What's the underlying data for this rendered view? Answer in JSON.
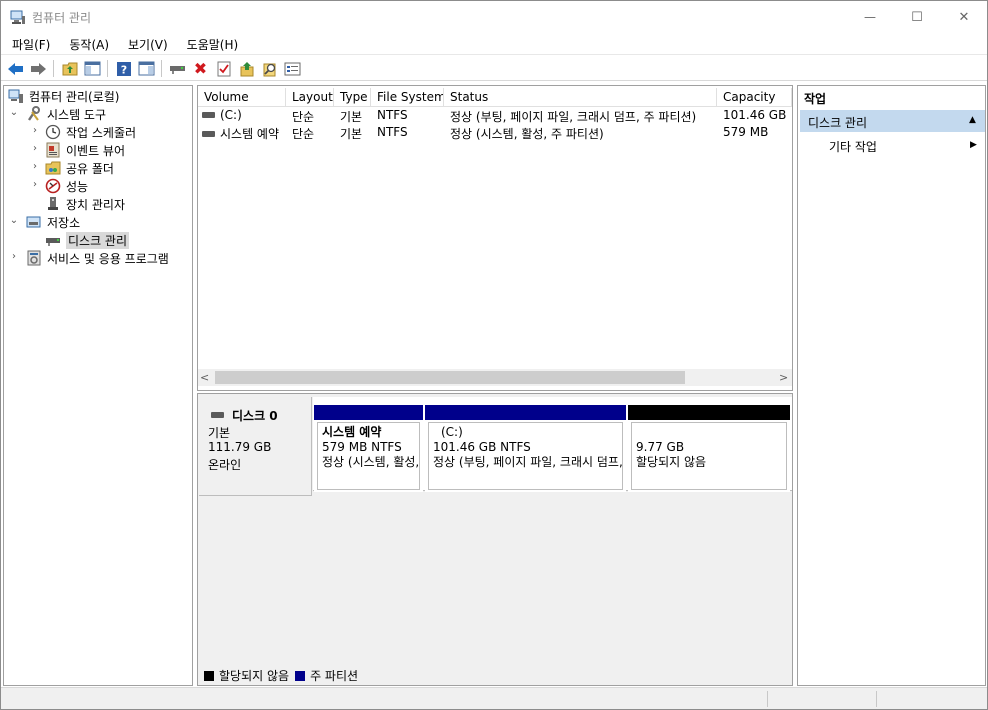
{
  "window": {
    "title": "컴퓨터 관리",
    "minimize_glyph": "—",
    "maximize_glyph": "☐",
    "close_glyph": "✕"
  },
  "menu": [
    "파일(F)",
    "동작(A)",
    "보기(V)",
    "도움말(H)"
  ],
  "toolbar": {
    "icons": [
      "back-arrow-icon",
      "forward-arrow-icon",
      "up-folder-icon",
      "show-hide-console-tree-icon",
      "help-icon",
      "show-hide-action-pane-icon",
      "connect-drive-icon",
      "delete-icon",
      "check-icon",
      "folder-up-icon",
      "search-icon",
      "properties-icon"
    ],
    "delete_glyph": "✖",
    "back_color": "#1f6fc5",
    "delete_color": "#d0191e"
  },
  "tree": {
    "root": "컴퓨터 관리(로컬)",
    "system_tools": "시스템 도구",
    "task_scheduler": "작업 스케줄러",
    "event_viewer": "이벤트 뷰어",
    "shared_folders": "공유 폴더",
    "performance": "성능",
    "device_manager": "장치 관리자",
    "storage": "저장소",
    "disk_management": "디스크 관리",
    "services_apps": "서비스 및 응용 프로그램",
    "chevron_expanded": "⌄",
    "chevron_collapsed": "›"
  },
  "volume_list": {
    "columns": [
      "Volume",
      "Layout",
      "Type",
      "File System",
      "Status",
      "Capacity"
    ],
    "rows": [
      {
        "volume": "(C:)",
        "layout": "단순",
        "type": "기본",
        "fs": "NTFS",
        "status": "정상 (부팅, 페이지 파일, 크래시 덤프, 주 파티션)",
        "capacity": "101.46 GB"
      },
      {
        "volume": "시스템 예약",
        "layout": "단순",
        "type": "기본",
        "fs": "NTFS",
        "status": "정상 (시스템, 활성, 주 파티션)",
        "capacity": "579 MB"
      }
    ],
    "scroll_left": "<",
    "scroll_right": ">"
  },
  "disk_map": {
    "disk_name": "디스크 0",
    "disk_type": "기본",
    "disk_size": "111.79 GB",
    "disk_state": "온라인",
    "partitions": [
      {
        "name": "시스템 예약",
        "size": "579 MB NTFS",
        "status": "정상 (시스템, 활성, 주 파티션)",
        "bar_color": "#00008b"
      },
      {
        "name": "(C:)",
        "size": "101.46 GB NTFS",
        "status": "정상 (부팅, 페이지 파일, 크래시 덤프, 주 파티션)",
        "bar_color": "#00008b"
      },
      {
        "name": "",
        "size": "9.77 GB",
        "status": "할당되지 않음",
        "bar_color": "#000000"
      }
    ],
    "legend": [
      {
        "label": "할당되지 않음",
        "color": "#000000"
      },
      {
        "label": "주 파티션",
        "color": "#00008b"
      }
    ]
  },
  "actions": {
    "title": "작업",
    "section": "디스크 관리",
    "section_caret": "▲",
    "more_actions": "기타 작업",
    "more_arrow": "▶",
    "header_color": "#c3d9ee"
  }
}
